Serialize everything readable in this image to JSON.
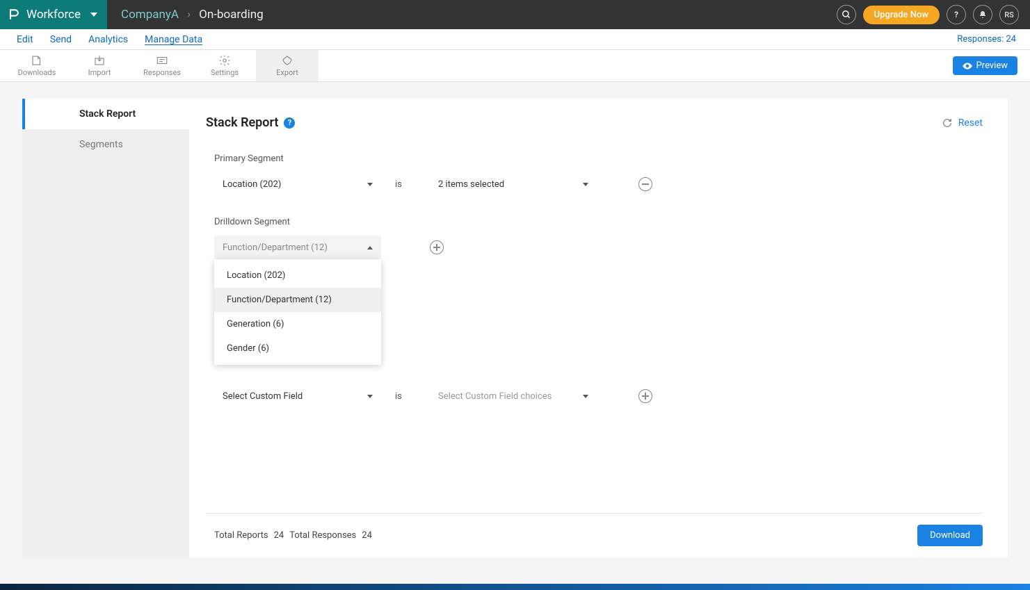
{
  "topbar": {
    "product": "Workforce",
    "company": "CompanyA",
    "page": "On-boarding",
    "upgrade": "Upgrade Now",
    "avatar": "RS"
  },
  "nav": {
    "edit": "Edit",
    "send": "Send",
    "analytics": "Analytics",
    "manage_data": "Manage Data",
    "responses_label": "Responses: 24"
  },
  "toolbar": {
    "downloads": "Downloads",
    "import": "Import",
    "responses": "Responses",
    "settings": "Settings",
    "export": "Export",
    "preview": "Preview"
  },
  "sidebar": {
    "stack_report": "Stack Report",
    "segments": "Segments"
  },
  "page": {
    "title": "Stack Report",
    "reset": "Reset",
    "primary_label": "Primary Segment",
    "primary_value": "Location (202)",
    "is": "is",
    "primary_items": "2 items selected",
    "drilldown_label": "Drilldown Segment",
    "drilldown_value": "Function/Department (12)",
    "dropdown": {
      "opt1": "Location (202)",
      "opt2": "Function/Department (12)",
      "opt3": "Generation (6)",
      "opt4": "Gender (6)"
    },
    "custom_field": "Select Custom Field",
    "custom_choices": "Select Custom Field choices"
  },
  "footer": {
    "total_reports_label": "Total Reports",
    "total_reports": "24",
    "total_responses_label": "Total Responses",
    "total_responses": "24",
    "download": "Download"
  }
}
